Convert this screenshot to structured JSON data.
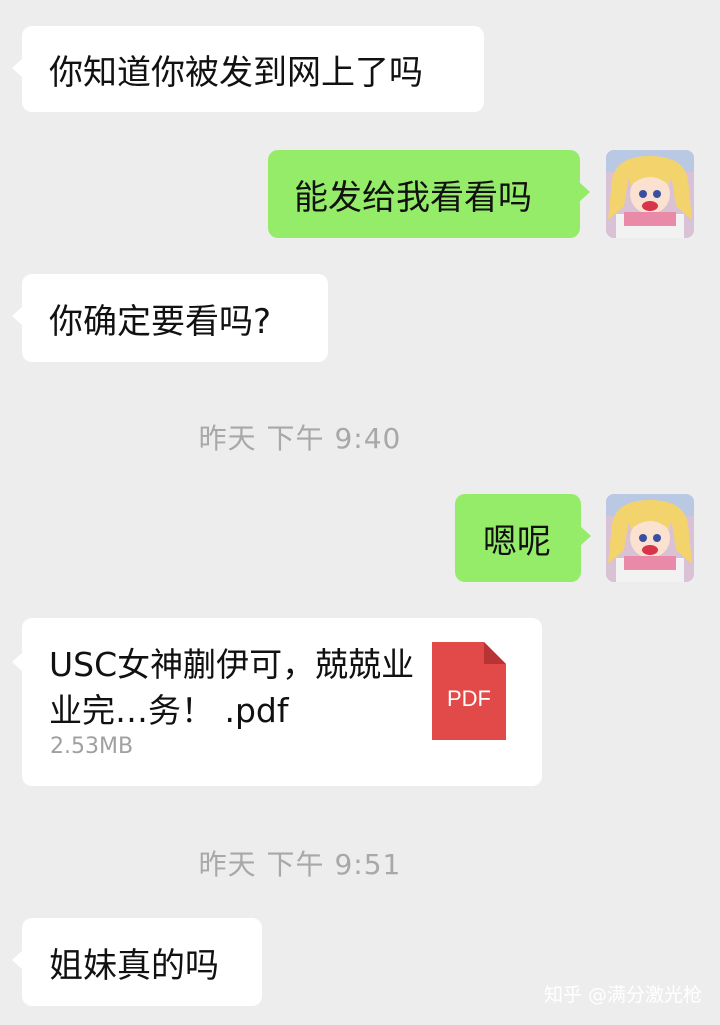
{
  "messages": [
    {
      "text": "你知道你被发到网上了吗"
    },
    {
      "text": "能发给我看看吗"
    },
    {
      "text": "你确定要看吗?"
    },
    {
      "text": "嗯呢"
    },
    {
      "text": "姐妹真的吗"
    }
  ],
  "timestamps": [
    "昨天 下午 9:40",
    "昨天 下午 9:51"
  ],
  "file": {
    "name": "USC女神蒯伊可，兢兢业业完…务！ .pdf",
    "size": "2.53MB",
    "icon_label": "PDF",
    "icon": "pdf-file-icon",
    "icon_color": "#e24a4a"
  },
  "avatar_icon": "anime-girl-avatar-icon",
  "watermark": "知乎 @满分激光枪",
  "colors": {
    "background": "#ededed",
    "sent_bubble": "#95ec69",
    "received_bubble": "#ffffff",
    "timestamp": "#a8a8a8"
  }
}
